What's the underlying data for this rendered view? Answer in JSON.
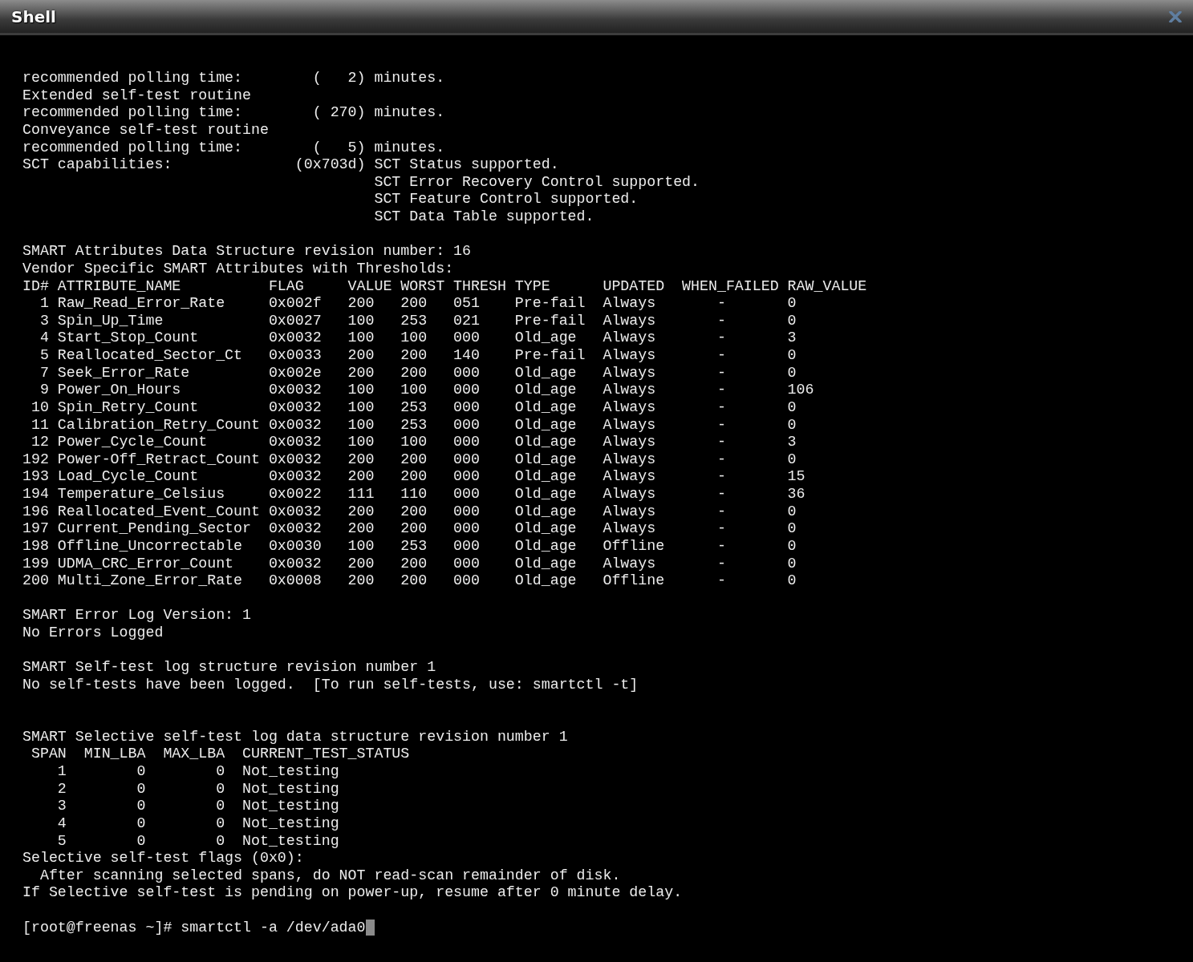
{
  "window": {
    "title": "Shell"
  },
  "terminal": {
    "lines": [
      {
        "kind": "text",
        "text": "recommended polling time:        (   2) minutes."
      },
      {
        "kind": "text",
        "text": "Extended self-test routine"
      },
      {
        "kind": "text",
        "text": "recommended polling time:        ( 270) minutes."
      },
      {
        "kind": "text",
        "text": "Conveyance self-test routine"
      },
      {
        "kind": "text",
        "text": "recommended polling time:        (   5) minutes."
      },
      {
        "kind": "text",
        "text": "SCT capabilities:              (0x703d) SCT Status supported."
      },
      {
        "kind": "text",
        "text": "                                        SCT Error Recovery Control supported."
      },
      {
        "kind": "text",
        "text": "                                        SCT Feature Control supported."
      },
      {
        "kind": "text",
        "text": "                                        SCT Data Table supported."
      },
      {
        "kind": "blank"
      },
      {
        "kind": "text",
        "text": "SMART Attributes Data Structure revision number: 16"
      },
      {
        "kind": "text",
        "text": "Vendor Specific SMART Attributes with Thresholds:"
      },
      {
        "kind": "text",
        "text": "ID# ATTRIBUTE_NAME          FLAG     VALUE WORST THRESH TYPE      UPDATED  WHEN_FAILED RAW_VALUE"
      },
      {
        "kind": "text",
        "text": "  1 Raw_Read_Error_Rate     0x002f   200   200   051    Pre-fail  Always       -       0"
      },
      {
        "kind": "text",
        "text": "  3 Spin_Up_Time            0x0027   100   253   021    Pre-fail  Always       -       0"
      },
      {
        "kind": "text",
        "text": "  4 Start_Stop_Count        0x0032   100   100   000    Old_age   Always       -       3"
      },
      {
        "kind": "text",
        "text": "  5 Reallocated_Sector_Ct   0x0033   200   200   140    Pre-fail  Always       -       0"
      },
      {
        "kind": "text",
        "text": "  7 Seek_Error_Rate         0x002e   200   200   000    Old_age   Always       -       0"
      },
      {
        "kind": "text",
        "text": "  9 Power_On_Hours          0x0032   100   100   000    Old_age   Always       -       106"
      },
      {
        "kind": "text",
        "text": " 10 Spin_Retry_Count        0x0032   100   253   000    Old_age   Always       -       0"
      },
      {
        "kind": "text",
        "text": " 11 Calibration_Retry_Count 0x0032   100   253   000    Old_age   Always       -       0"
      },
      {
        "kind": "text",
        "text": " 12 Power_Cycle_Count       0x0032   100   100   000    Old_age   Always       -       3"
      },
      {
        "kind": "text",
        "text": "192 Power-Off_Retract_Count 0x0032   200   200   000    Old_age   Always       -       0"
      },
      {
        "kind": "text",
        "text": "193 Load_Cycle_Count        0x0032   200   200   000    Old_age   Always       -       15"
      },
      {
        "kind": "text",
        "text": "194 Temperature_Celsius     0x0022   111   110   000    Old_age   Always       -       36"
      },
      {
        "kind": "text",
        "text": "196 Reallocated_Event_Count 0x0032   200   200   000    Old_age   Always       -       0"
      },
      {
        "kind": "text",
        "text": "197 Current_Pending_Sector  0x0032   200   200   000    Old_age   Always       -       0"
      },
      {
        "kind": "text",
        "text": "198 Offline_Uncorrectable   0x0030   100   253   000    Old_age   Offline      -       0"
      },
      {
        "kind": "text",
        "text": "199 UDMA_CRC_Error_Count    0x0032   200   200   000    Old_age   Always       -       0"
      },
      {
        "kind": "text",
        "text": "200 Multi_Zone_Error_Rate   0x0008   200   200   000    Old_age   Offline      -       0"
      },
      {
        "kind": "blank"
      },
      {
        "kind": "text",
        "text": "SMART Error Log Version: 1"
      },
      {
        "kind": "text",
        "text": "No Errors Logged"
      },
      {
        "kind": "blank"
      },
      {
        "kind": "text",
        "text": "SMART Self-test log structure revision number 1"
      },
      {
        "kind": "text",
        "text": "No self-tests have been logged.  [To run self-tests, use: smartctl -t]"
      },
      {
        "kind": "blank"
      },
      {
        "kind": "blank"
      },
      {
        "kind": "text",
        "text": "SMART Selective self-test log data structure revision number 1"
      },
      {
        "kind": "text",
        "text": " SPAN  MIN_LBA  MAX_LBA  CURRENT_TEST_STATUS"
      },
      {
        "kind": "text",
        "text": "    1        0        0  Not_testing"
      },
      {
        "kind": "text",
        "text": "    2        0        0  Not_testing"
      },
      {
        "kind": "text",
        "text": "    3        0        0  Not_testing"
      },
      {
        "kind": "text",
        "text": "    4        0        0  Not_testing"
      },
      {
        "kind": "text",
        "text": "    5        0        0  Not_testing"
      },
      {
        "kind": "text",
        "text": "Selective self-test flags (0x0):"
      },
      {
        "kind": "text",
        "text": "  After scanning selected spans, do NOT read-scan remainder of disk."
      },
      {
        "kind": "text",
        "text": "If Selective self-test is pending on power-up, resume after 0 minute delay."
      },
      {
        "kind": "blank"
      },
      {
        "kind": "prompt",
        "text": "[root@freenas ~]# smartctl -a /dev/ada0"
      }
    ]
  }
}
